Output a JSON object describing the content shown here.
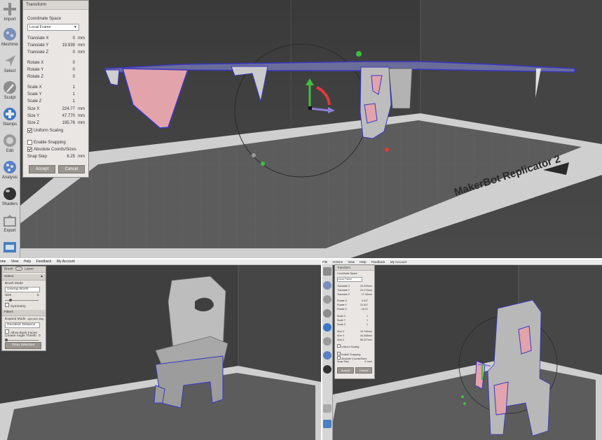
{
  "top": {
    "toolbar": [
      {
        "label": "Import",
        "icon": "plus-icon"
      },
      {
        "label": "Meshmix",
        "icon": "meshmix-icon"
      },
      {
        "label": "Select",
        "icon": "select-arrow-icon"
      },
      {
        "label": "Sculpt",
        "icon": "brush-icon"
      },
      {
        "label": "Stamps",
        "icon": "stamp-icon"
      },
      {
        "label": "Edit",
        "icon": "edit-icon"
      },
      {
        "label": "Analysis",
        "icon": "analysis-icon"
      },
      {
        "label": "Shaders",
        "icon": "shader-sphere-icon"
      },
      {
        "label": "Export",
        "icon": "export-icon"
      },
      {
        "label": "",
        "icon": "print-icon"
      }
    ],
    "panel": {
      "title": "Transform",
      "coord_label": "Coordinate Space",
      "coord_value": "Local Frame",
      "fields": [
        {
          "label": "Translate X",
          "value": "0",
          "unit": "mm"
        },
        {
          "label": "Translate Y",
          "value": "19.939",
          "unit": "mm"
        },
        {
          "label": "Translate Z",
          "value": "0",
          "unit": "mm"
        },
        {
          "label": "Rotate X",
          "value": "0",
          "unit": ""
        },
        {
          "label": "Rotate Y",
          "value": "0",
          "unit": ""
        },
        {
          "label": "Rotate Z",
          "value": "0",
          "unit": ""
        },
        {
          "label": "Scale X",
          "value": "1",
          "unit": ""
        },
        {
          "label": "Scale Y",
          "value": "1",
          "unit": ""
        },
        {
          "label": "Scale Z",
          "value": "1",
          "unit": ""
        },
        {
          "label": "Size X",
          "value": "224.77",
          "unit": "mm"
        },
        {
          "label": "Size Y",
          "value": "47.770",
          "unit": "mm"
        },
        {
          "label": "Size Z",
          "value": "195.76",
          "unit": "mm"
        }
      ],
      "uniform_scaling": "Uniform Scaling",
      "enable_snapping": "Enable Snapping",
      "absolute_coords": "Absolute Coords/Sizes",
      "snap_label": "Snap Step",
      "snap_value": "6.25",
      "snap_unit": "mm",
      "accept": "Accept",
      "cancel": "Cancel"
    },
    "bed_label": "MakerBot Replicator 2"
  },
  "bottom_left": {
    "menu": [
      "one",
      "View",
      "Help",
      "Feedback",
      "My Account"
    ],
    "tabs": {
      "brush": "Brush",
      "lasso": "Lasso"
    },
    "select_header": "Select",
    "brush_mode_label": "Brush Mode",
    "brush_mode_value": "Unwrap Brush",
    "size_label": "Size",
    "size_value": "6",
    "symmetry": "Symmetry",
    "filters_header": "Filters",
    "expand_label": "Expand Mode",
    "expand_hint": "right-click drag",
    "expand_value": "Geodesic Distance",
    "allow_back": "Allow Back Faces",
    "crease_label": "Crease Angle Thresh",
    "crease_value": "0",
    "clear_button": "Clear Selection"
  },
  "bottom_right": {
    "menu": [
      "File",
      "Actions",
      "View",
      "Help",
      "Feedback",
      "My Account"
    ],
    "panel_title": "Transform",
    "coord_label": "Coordinate Space",
    "coord_value": "Local Frame",
    "fields": [
      {
        "label": "Translate X",
        "value": "25.200",
        "unit": "mm"
      },
      {
        "label": "Translate Y",
        "value": "24.172",
        "unit": "mm"
      },
      {
        "label": "Translate Z",
        "value": "-17.05",
        "unit": "mm"
      },
      {
        "label": "Rotate X",
        "value": "4.317",
        "unit": ""
      },
      {
        "label": "Rotate Y",
        "value": "31.007",
        "unit": ""
      },
      {
        "label": "Rotate Z",
        "value": "-16.21",
        "unit": ""
      },
      {
        "label": "Scale X",
        "value": "1",
        "unit": ""
      },
      {
        "label": "Scale Y",
        "value": "1",
        "unit": ""
      },
      {
        "label": "Scale Z",
        "value": "1",
        "unit": ""
      },
      {
        "label": "Size X",
        "value": "15.745",
        "unit": "mm"
      },
      {
        "label": "Size Y",
        "value": "44.308",
        "unit": "mm"
      },
      {
        "label": "Size Z",
        "value": "86.327",
        "unit": "mm"
      }
    ],
    "uniform_scaling": "Uniform Scaling",
    "enable_snapping": "Enable Snapping",
    "absolute_coords": "Absolute Coords/Sizes",
    "snap_label": "Snap Step",
    "snap_value": "2.1",
    "snap_unit": "mm",
    "accept": "Accept",
    "cancel": "Cancel"
  }
}
